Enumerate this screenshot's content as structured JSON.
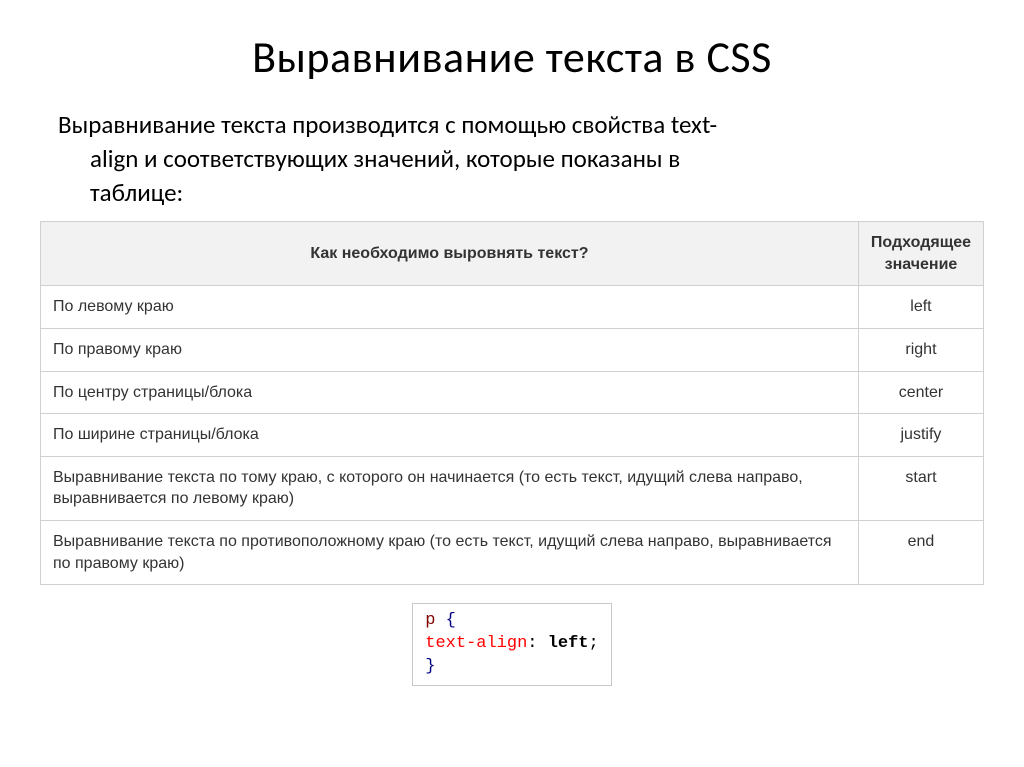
{
  "title": "Выравнивание текста в CSS",
  "intro_line1": "Выравнивание текста производится с помощью свойства text-",
  "intro_line2": "align и соответствующих значений, которые показаны в",
  "intro_line3": "таблице:",
  "table": {
    "head_desc": "Как необходимо выровнять текст?",
    "head_val": "Подходящее значение",
    "rows": [
      {
        "desc": "По левому краю",
        "val": "left"
      },
      {
        "desc": "По правому краю",
        "val": "right"
      },
      {
        "desc": "По центру страницы/блока",
        "val": "center"
      },
      {
        "desc": "По ширине страницы/блока",
        "val": "justify"
      },
      {
        "desc": "Выравнивание текста по тому краю, с которого он начинается (то есть текст, идущий слева направо, выравнивается по левому краю)",
        "val": "start"
      },
      {
        "desc": "Выравнивание текста по противоположному краю (то есть текст, идущий слева направо, выравнивается по правому краю)",
        "val": "end"
      }
    ]
  },
  "code": {
    "selector": "p",
    "brace_open": "{",
    "prop": "text-align",
    "colon": ":",
    "val": "left",
    "semi": ";",
    "brace_close": "}"
  }
}
